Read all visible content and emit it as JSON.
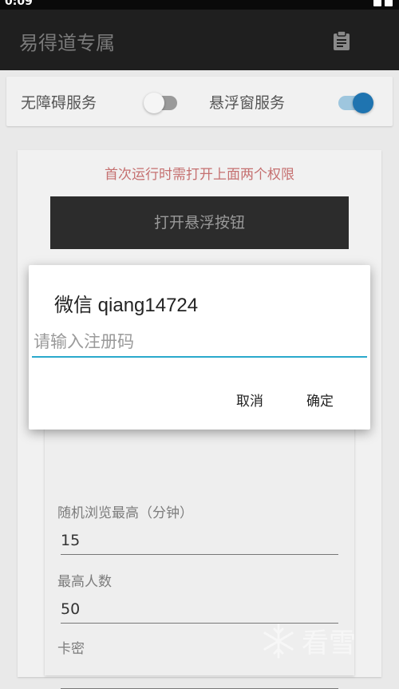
{
  "status_bar": {
    "time": "0:09"
  },
  "app_bar": {
    "title": "易得道专属",
    "action_icon": "clipboard-icon"
  },
  "switches": [
    {
      "label": "无障碍服务",
      "on": false
    },
    {
      "label": "悬浮窗服务",
      "on": true
    }
  ],
  "main": {
    "notice": "首次运行时需打开上面两个权限",
    "float_button": "打开悬浮按钮",
    "fields": [
      {
        "label": "随机浏览最高（分钟）",
        "value": "15"
      },
      {
        "label": "最高人数",
        "value": "50"
      },
      {
        "label": "卡密",
        "value": ""
      }
    ]
  },
  "dialog": {
    "title": "微信 qiang14724",
    "input_placeholder": "请输入注册码",
    "input_value": "",
    "cancel": "取消",
    "confirm": "确定"
  },
  "watermark": {
    "text": "看雪",
    "icon": "snowflake-icon"
  },
  "colors": {
    "accent": "#2aa9cc",
    "toggle_on_thumb": "#1f74b0",
    "toggle_on_track": "#9ec6de",
    "toggle_off_thumb": "#f5f5f5",
    "toggle_off_track": "#9a9a9a",
    "notice_text": "#c57070"
  }
}
